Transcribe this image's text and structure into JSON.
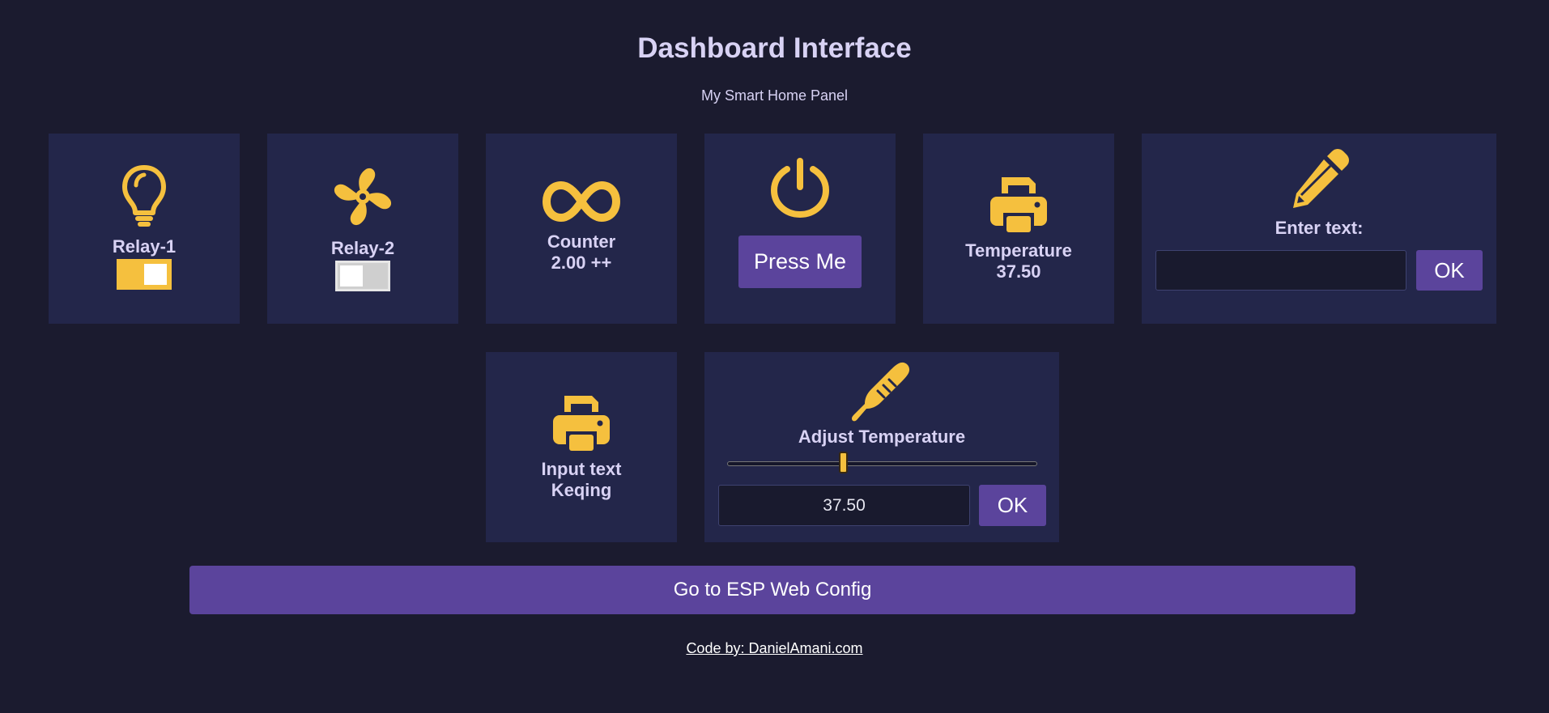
{
  "header": {
    "title": "Dashboard Interface",
    "subtitle": "My Smart Home Panel"
  },
  "cards": {
    "relay1": {
      "icon": "lightbulb-icon",
      "label": "Relay-1",
      "state": "on"
    },
    "relay2": {
      "icon": "fan-icon",
      "label": "Relay-2",
      "state": "off"
    },
    "counter": {
      "icon": "infinity-icon",
      "label": "Counter",
      "value": "2.00 ++"
    },
    "press": {
      "icon": "power-icon",
      "button_label": "Press Me"
    },
    "temperature": {
      "icon": "printer-icon",
      "label": "Temperature",
      "value": "37.50"
    },
    "enter_text": {
      "icon": "pencil-icon",
      "label": "Enter text:",
      "input_value": "",
      "ok_label": "OK"
    },
    "input_text": {
      "icon": "printer-icon",
      "label": "Input text",
      "value": "Keqing"
    },
    "adjust_temp": {
      "icon": "thermometer-icon",
      "label": "Adjust Temperature",
      "slider_fraction": 0.37,
      "input_value": "37.50",
      "ok_label": "OK"
    }
  },
  "config_button_label": "Go to ESP Web Config",
  "footer_link": "Code by: DanielAmani.com",
  "colors": {
    "background": "#1b1b2f",
    "card": "#23264a",
    "accent_yellow": "#f5c03e",
    "accent_purple": "#5b449c",
    "text": "#d8d2f4"
  }
}
